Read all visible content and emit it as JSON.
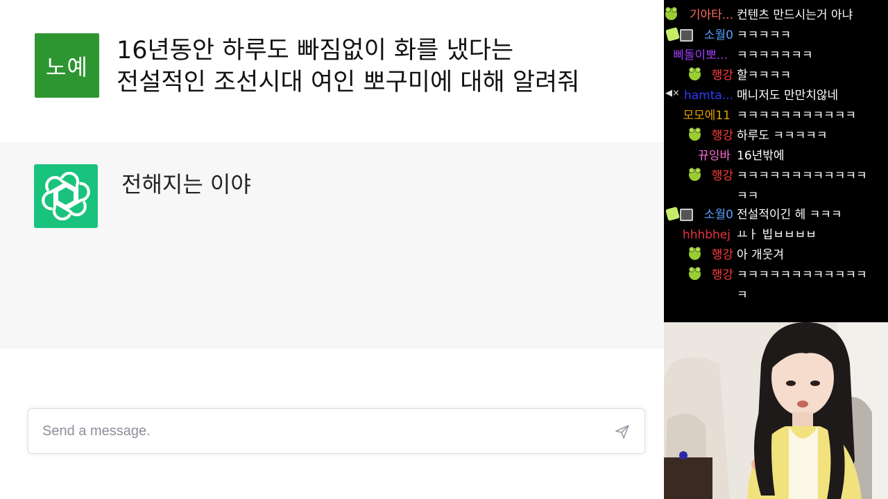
{
  "chat": {
    "user_avatar_label": "노예",
    "user_message_lines": [
      "16년동안 하루도 빠짐없이 화를 냈다는",
      "전설적인 조선시대 여인 뽀구미에 대해 알려줘"
    ],
    "assistant_avatar_icon": "openai-logo-icon",
    "assistant_message": "전해지는 이야",
    "input_placeholder": "Send a message.",
    "send_icon": "send-icon",
    "colors": {
      "user_avatar_bg": "#2e9630",
      "assistant_avatar_bg": "#19c37d",
      "assistant_row_bg": "#f7f7f8"
    }
  },
  "stream_chat": {
    "messages": [
      {
        "nick": "기아타...",
        "nick_color": "#ff6a5e",
        "text": "컨텐츠 만드시는거 아냐",
        "badges": [
          "frog-badge-icon"
        ]
      },
      {
        "nick": "소월0",
        "nick_color": "#5aa0ff",
        "text": "ㅋㅋㅋㅋㅋ",
        "badges": [
          "cat-badge-icon",
          "box-badge-icon"
        ]
      },
      {
        "nick": "삐돌이뽀...",
        "nick_color": "#a040ff",
        "text": "ㅋㅋㅋㅋㅋㅋㅋ",
        "badges": []
      },
      {
        "nick": "행강",
        "nick_color": "#ff3b3b",
        "text": "할ㅋㅋㅋㅋ",
        "badges": [
          "frog-badge-icon"
        ]
      },
      {
        "nick": "hamta...",
        "nick_color": "#2a3cff",
        "text": "매니저도 만만치않네",
        "badges": [
          "mute-badge-icon"
        ]
      },
      {
        "nick": "모모에11",
        "nick_color": "#e0a000",
        "text": "ㅋㅋㅋㅋㅋㅋㅋㅋㅋㅋㅋ",
        "badges": []
      },
      {
        "nick": "행강",
        "nick_color": "#ff3b3b",
        "text": "하루도 ㅋㅋㅋㅋㅋ",
        "badges": [
          "frog-badge-icon"
        ]
      },
      {
        "nick": "뀨잉바",
        "nick_color": "#ff6ad5",
        "text": "16년밖에",
        "badges": []
      },
      {
        "nick": "행강",
        "nick_color": "#ff3b3b",
        "text": "ㅋㅋㅋㅋㅋㅋㅋㅋㅋㅋㅋㅋ",
        "extra": "ㅋㅋ",
        "badges": [
          "frog-badge-icon"
        ]
      },
      {
        "nick": "소월0",
        "nick_color": "#5aa0ff",
        "text": "전설적이긴 헤 ㅋㅋㅋ",
        "badges": [
          "cat-badge-icon",
          "box-badge-icon"
        ]
      },
      {
        "nick": "hhhbhej",
        "nick_color": "#e8323c",
        "text": "ㅛㅏ 빕ㅂㅂㅂㅂ",
        "badges": []
      },
      {
        "nick": "행강",
        "nick_color": "#ff3b3b",
        "text": "아 개웃겨",
        "badges": [
          "frog-badge-icon"
        ]
      },
      {
        "nick": "행강",
        "nick_color": "#ff3b3b",
        "text": "ㅋㅋㅋㅋㅋㅋㅋㅋㅋㅋㅋㅋ",
        "extra": "ㅋ",
        "badges": [
          "frog-badge-icon"
        ]
      }
    ]
  },
  "webcam": {
    "icon": "streamer-webcam-feed"
  }
}
